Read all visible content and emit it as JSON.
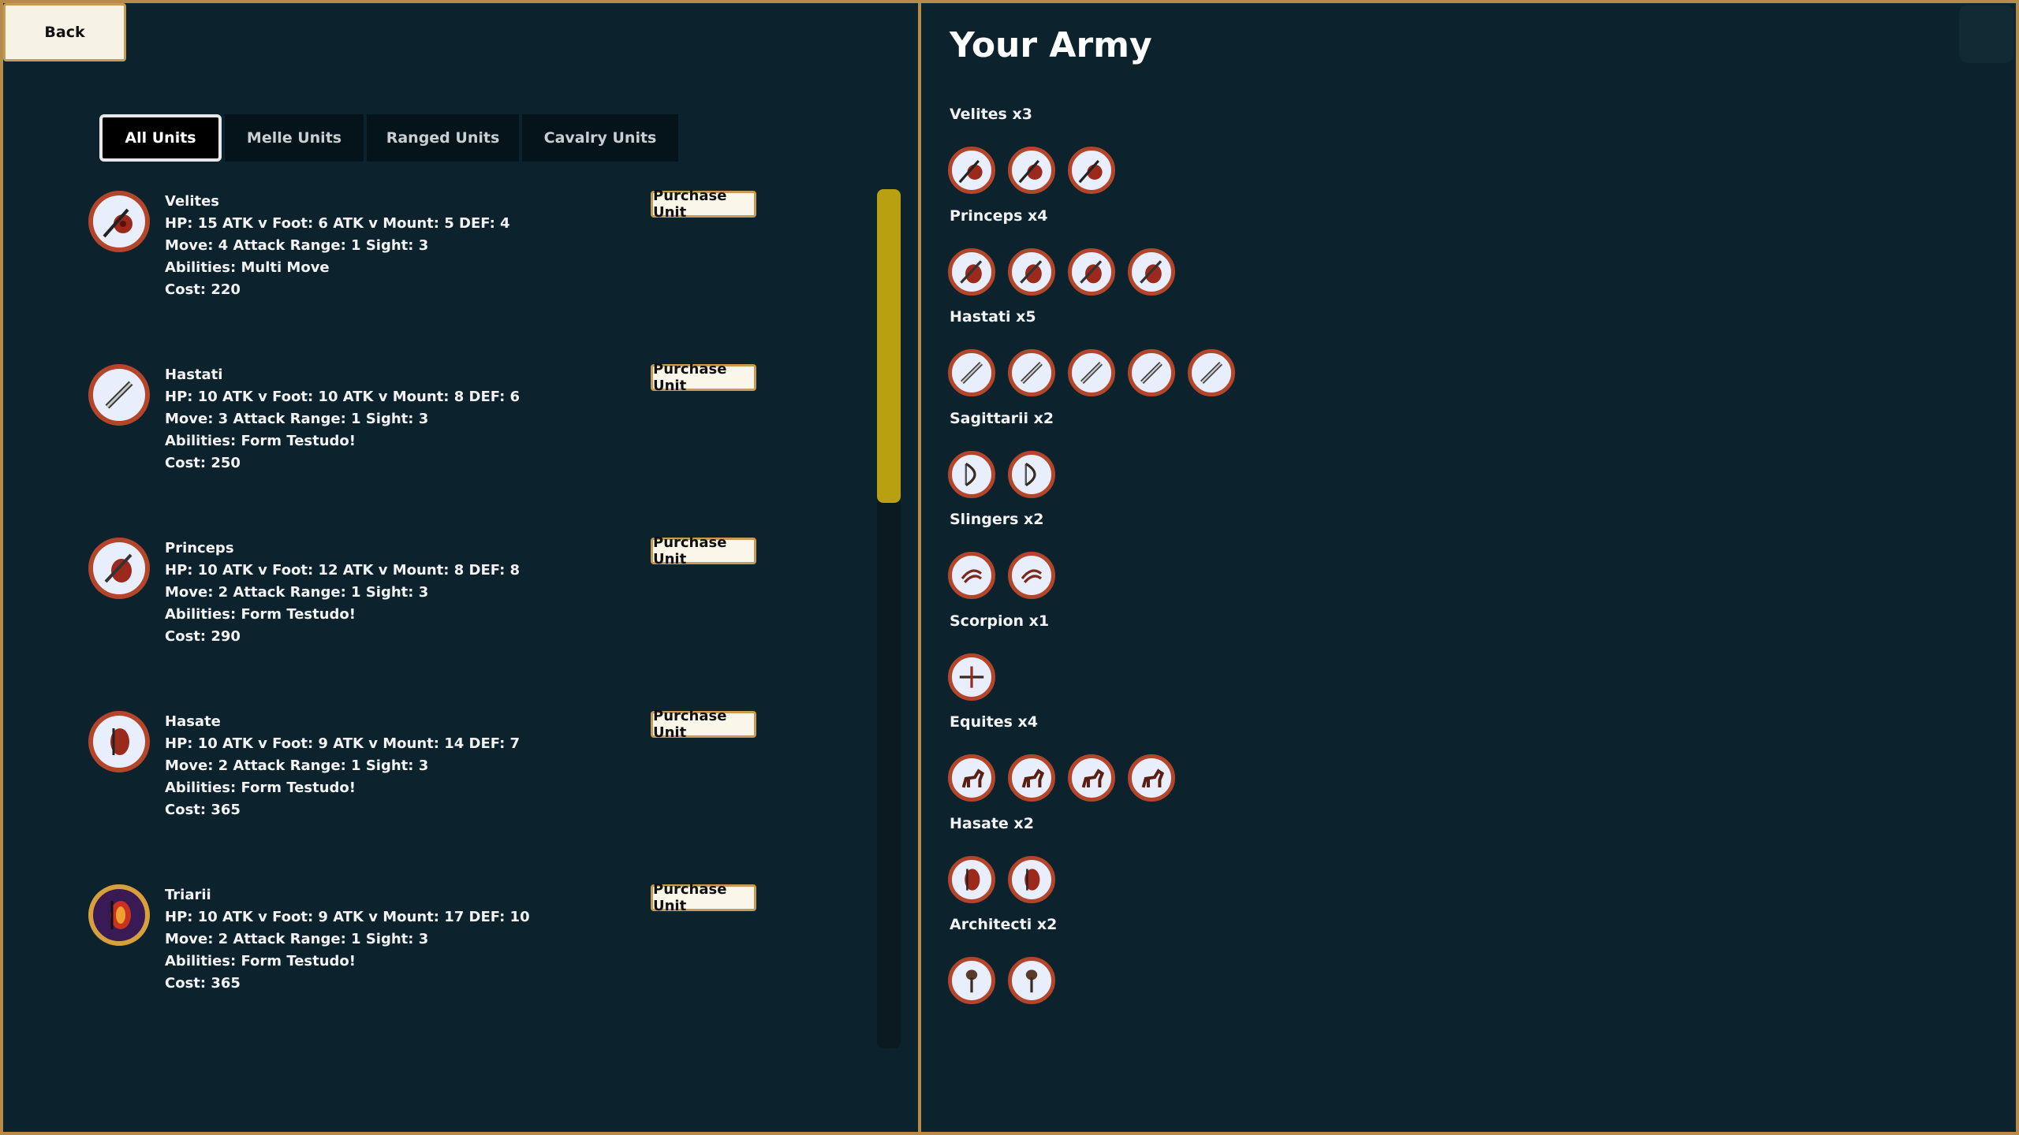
{
  "nav": {
    "back_label": "Back"
  },
  "tabs": [
    {
      "label": "All Units",
      "active": true
    },
    {
      "label": "Melle Units",
      "active": false
    },
    {
      "label": "Ranged Units",
      "active": false
    },
    {
      "label": "Cavalry Units",
      "active": false
    }
  ],
  "purchase_label": "Purchase Unit",
  "units": [
    {
      "name": "Velites",
      "icon": "javelin-shield-icon",
      "stats": "HP: 15  ATK v Foot: 6 ATK v Mount: 5  DEF: 4",
      "move": "Move: 4  Attack Range: 1 Sight: 3",
      "abilities": "Abilities: Multi Move",
      "cost": "Cost: 220"
    },
    {
      "name": "Hastati",
      "icon": "sword-icon",
      "stats": "HP: 10  ATK v Foot: 10 ATK v Mount: 8  DEF: 6",
      "move": "Move: 3  Attack Range: 1 Sight: 3",
      "abilities": "Abilities: Form Testudo!",
      "cost": "Cost: 250"
    },
    {
      "name": "Princeps",
      "icon": "sword-shield-icon",
      "stats": "HP: 10  ATK v Foot: 12 ATK v Mount: 8  DEF: 8",
      "move": "Move: 2  Attack Range: 1 Sight: 3",
      "abilities": "Abilities: Form Testudo!",
      "cost": "Cost: 290"
    },
    {
      "name": "Hasate",
      "icon": "tower-shield-icon",
      "stats": "HP: 10  ATK v Foot: 9 ATK v Mount: 14  DEF: 7",
      "move": "Move: 2  Attack Range: 1 Sight: 3",
      "abilities": "Abilities: Form Testudo!",
      "cost": "Cost: 365"
    },
    {
      "name": "Triarii",
      "icon": "great-shield-icon",
      "stats": "HP: 10  ATK v Foot: 9 ATK v Mount: 17  DEF: 10",
      "move": "Move: 2  Attack Range: 1 Sight: 3",
      "abilities": "Abilities: Form Testudo!",
      "cost": "Cost: 365"
    }
  ],
  "army": {
    "title": "Your Army",
    "groups": [
      {
        "label": "Velites x3",
        "count": 3,
        "icon": "javelin-shield-icon"
      },
      {
        "label": "Princeps x4",
        "count": 4,
        "icon": "sword-shield-icon"
      },
      {
        "label": "Hastati x5",
        "count": 5,
        "icon": "sword-icon"
      },
      {
        "label": "Sagittarii x2",
        "count": 2,
        "icon": "bow-icon"
      },
      {
        "label": "Slingers x2",
        "count": 2,
        "icon": "sling-icon"
      },
      {
        "label": "Scorpion x1",
        "count": 1,
        "icon": "crossbow-icon"
      },
      {
        "label": "Equites x4",
        "count": 4,
        "icon": "horse-icon"
      },
      {
        "label": "Hasate x2",
        "count": 2,
        "icon": "tower-shield-icon"
      },
      {
        "label": "Architecti x2",
        "count": 2,
        "icon": "hammer-icon"
      }
    ]
  },
  "colors": {
    "background": "#0c222c",
    "frame": "#b58a4a",
    "scroll_thumb": "#b8a010",
    "icon_ring": "#b3452b"
  }
}
